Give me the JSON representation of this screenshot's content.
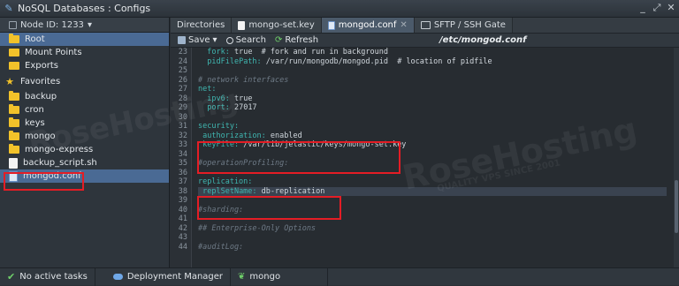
{
  "window": {
    "title": "NoSQL Databases : Configs",
    "controls": [
      "_",
      "⤢",
      "✕"
    ]
  },
  "sidebar": {
    "node_label": "Node ID: 1233",
    "root_items": [
      {
        "label": "Root",
        "icon": "folder-icon",
        "selected": true
      },
      {
        "label": "Mount Points",
        "icon": "mount-icon"
      },
      {
        "label": "Exports",
        "icon": "export-icon"
      }
    ],
    "favorites_label": "Favorites",
    "favorites": [
      {
        "label": "backup",
        "icon": "folder-icon"
      },
      {
        "label": "cron",
        "icon": "folder-icon"
      },
      {
        "label": "keys",
        "icon": "folder-icon"
      },
      {
        "label": "mongo",
        "icon": "folder-icon"
      },
      {
        "label": "mongo-express",
        "icon": "folder-icon"
      },
      {
        "label": "backup_script.sh",
        "icon": "file-icon"
      },
      {
        "label": "mongod.conf",
        "icon": "conf-file-icon",
        "selected": true
      }
    ]
  },
  "tabs": [
    {
      "label": "Directories",
      "active": false
    },
    {
      "label": "mongo-set.key",
      "active": false
    },
    {
      "label": "mongod.conf",
      "active": true
    },
    {
      "label": "SFTP / SSH Gate",
      "active": false
    }
  ],
  "toolbar": {
    "save_label": "Save",
    "search_label": "Search",
    "refresh_label": "Refresh",
    "path": "/etc/mongod.conf"
  },
  "editor": {
    "line_numbers": [
      "23",
      "24",
      "25",
      "26",
      "27",
      "28",
      "29",
      "30",
      "31",
      "32",
      "33",
      "34",
      "35",
      "36",
      "37",
      "38",
      "39",
      "40",
      "41",
      "42",
      "43",
      "44"
    ],
    "lines": [
      "  fork: true  # fork and run in background",
      "  pidFilePath: /var/run/mongodb/mongod.pid  # location of pidfile",
      "",
      "# network interfaces",
      "net:",
      "  ipv6: true",
      "  port: 27017",
      "",
      "security:",
      " authorization: enabled",
      " keyFile: /var/lib/jelastic/keys/mongo-set.key",
      "",
      "#operationProfiling:",
      "",
      "replication:",
      " replSetName: db-replication",
      "",
      "#sharding:",
      "",
      "## Enterprise-Only Options",
      "",
      "#auditLog:"
    ]
  },
  "status": {
    "tasks_label": "No active tasks",
    "deployment_label": "Deployment Manager",
    "mongo_label": "mongo"
  },
  "watermark": {
    "text": "RoseHosting",
    "sub": "QUALITY VPS SINCE 2001"
  },
  "colors": {
    "highlight": "#e41d25",
    "selection": "#4a6a94",
    "key": "#3fb6b0",
    "folder": "#f2c22a"
  }
}
